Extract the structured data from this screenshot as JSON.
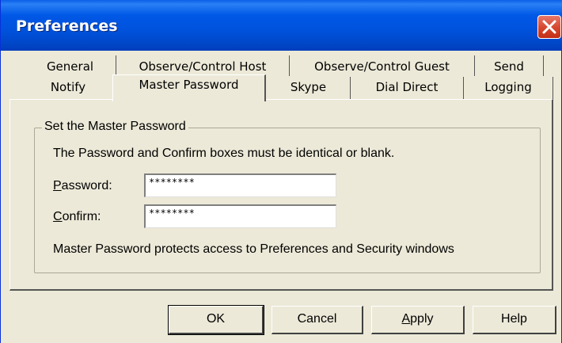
{
  "window": {
    "title": "Preferences"
  },
  "tabs": {
    "row1": [
      {
        "label": "General"
      },
      {
        "label": "Observe/Control Host"
      },
      {
        "label": "Observe/Control Guest"
      },
      {
        "label": "Send"
      }
    ],
    "row2": [
      {
        "label": "Notify"
      },
      {
        "label": "Master Password"
      },
      {
        "label": "Skype"
      },
      {
        "label": "Dial Direct"
      },
      {
        "label": "Logging"
      }
    ],
    "active": "Master Password"
  },
  "group": {
    "legend": "Set the Master Password",
    "instruction": "The Password and Confirm boxes must be identical or blank.",
    "password": {
      "label_underlined": "P",
      "label_rest": "assword:",
      "value": "********"
    },
    "confirm": {
      "label_underlined": "C",
      "label_rest": "onfirm:",
      "value": "********"
    },
    "note": "Master Password protects access to  Preferences and Security windows"
  },
  "buttons": {
    "ok": "OK",
    "cancel": "Cancel",
    "apply_underlined": "A",
    "apply_rest": "pply",
    "help": "Help"
  }
}
